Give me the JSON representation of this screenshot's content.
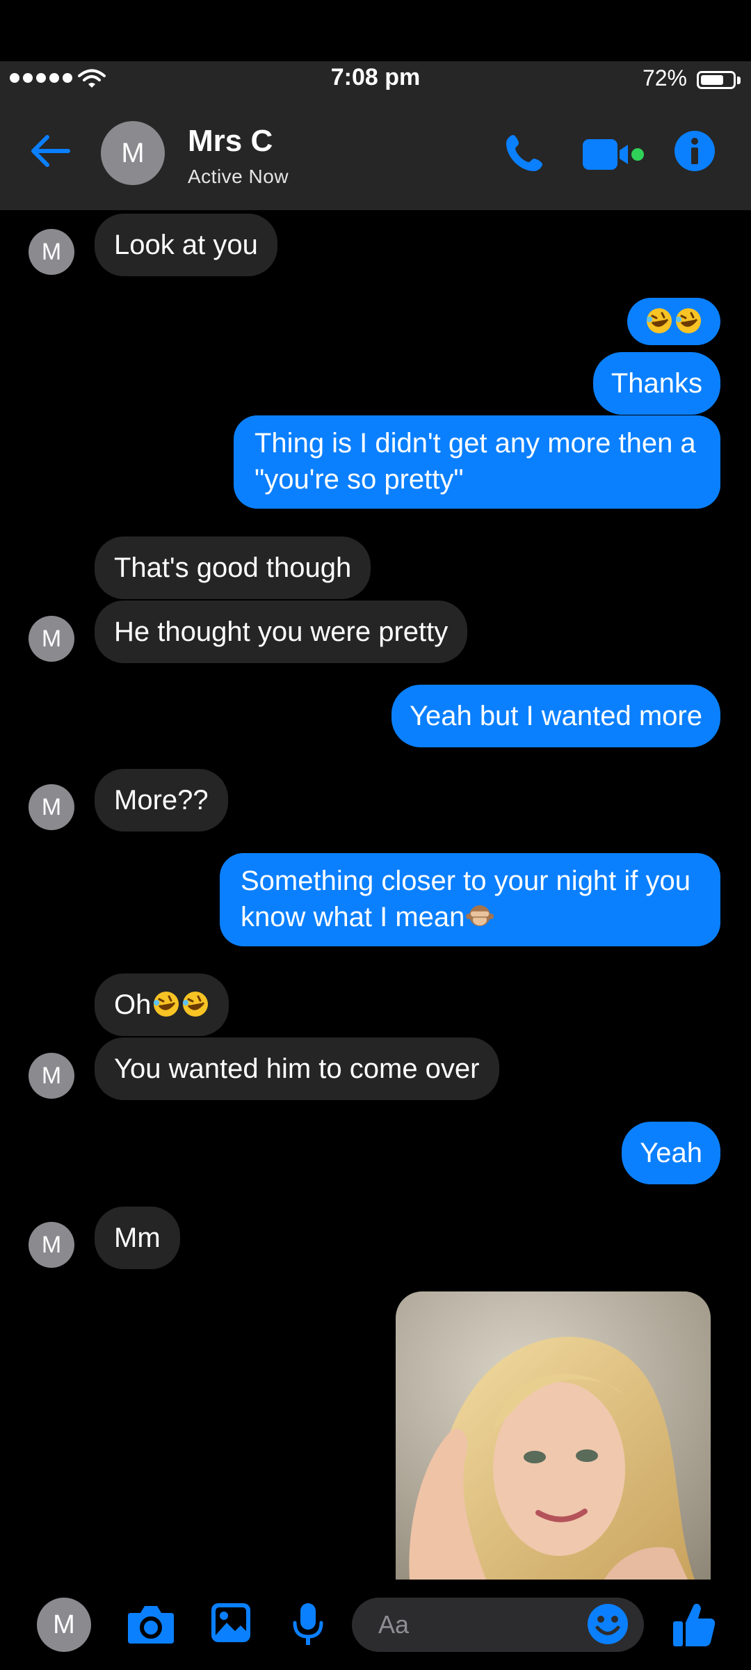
{
  "status_bar": {
    "time": "7:08 pm",
    "battery_percent": "72%",
    "battery_level": 0.72,
    "signal_dots": 5
  },
  "header": {
    "avatar_initial": "M",
    "contact_name": "Mrs C",
    "contact_status": "Active Now"
  },
  "colors": {
    "accent": "#0b80ff",
    "incoming_bubble": "#252525",
    "header_bg": "#262626",
    "online_dot": "#30d158"
  },
  "messages": [
    {
      "from": "them",
      "text": "Look at you"
    },
    {
      "from": "me",
      "text": "",
      "emoji": [
        "rolling-on-floor-laughing",
        "rolling-on-floor-laughing"
      ]
    },
    {
      "from": "me",
      "text": "Thanks"
    },
    {
      "from": "me",
      "line1": "Thing is I didn't get any more then a",
      "line2": "\"you're so pretty\""
    },
    {
      "from": "them",
      "text": "That's good though"
    },
    {
      "from": "them",
      "text": "He thought you were pretty"
    },
    {
      "from": "me",
      "text": "Yeah but I wanted more"
    },
    {
      "from": "them",
      "text": "More??"
    },
    {
      "from": "me",
      "line1": "Something closer to your night if you",
      "line2": "know what I mean",
      "emoji": [
        "see-no-evil-monkey"
      ]
    },
    {
      "from": "them",
      "text": "Oh",
      "emoji": [
        "rolling-on-floor-laughing",
        "rolling-on-floor-laughing"
      ]
    },
    {
      "from": "them",
      "text": "You wanted him to come over"
    },
    {
      "from": "me",
      "text": "Yeah"
    },
    {
      "from": "them",
      "text": "Mm"
    },
    {
      "from": "me",
      "type": "photo"
    }
  ],
  "avatar_initial": "M",
  "composer": {
    "avatar_initial": "M",
    "placeholder": "Aa",
    "icons": [
      "camera-icon",
      "gallery-icon",
      "microphone-icon",
      "emoji-icon",
      "thumbs-up-icon"
    ]
  }
}
